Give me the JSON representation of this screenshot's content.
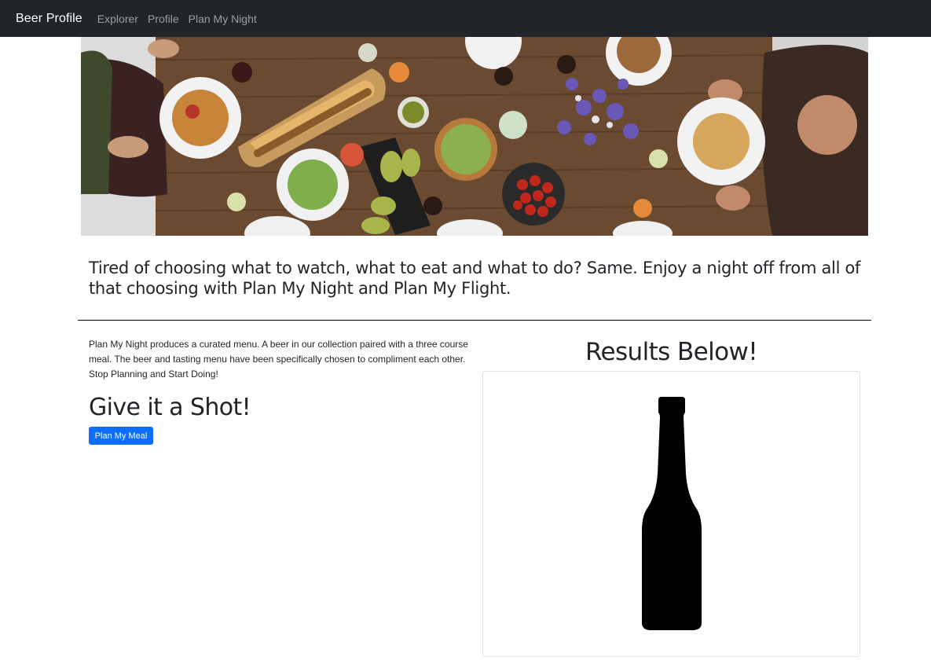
{
  "navbar": {
    "brand": "Beer Profile",
    "links": [
      "Explorer",
      "Profile",
      "Plan My Night"
    ]
  },
  "hero": {
    "image": "dinner-table-food-photo"
  },
  "intro": {
    "text": "Tired of choosing what to watch, what to eat and what to do? Same. Enjoy a night off from all of that choosing with Plan My Night and Plan My Flight."
  },
  "main": {
    "description": "Plan My Night produces a curated menu. A beer in our collection paired with a three course meal. The beer and tasting menu have been specifically chosen to compliment each other. Stop Planning and Start Doing!",
    "cta_heading": "Give it a Shot!",
    "button_label": "Plan My Meal"
  },
  "results": {
    "title": "Results Below!",
    "image": "beer-bottle-silhouette-icon"
  },
  "colors": {
    "navbar_bg": "#212529",
    "button_bg": "#0d6efd",
    "text": "#212529"
  }
}
